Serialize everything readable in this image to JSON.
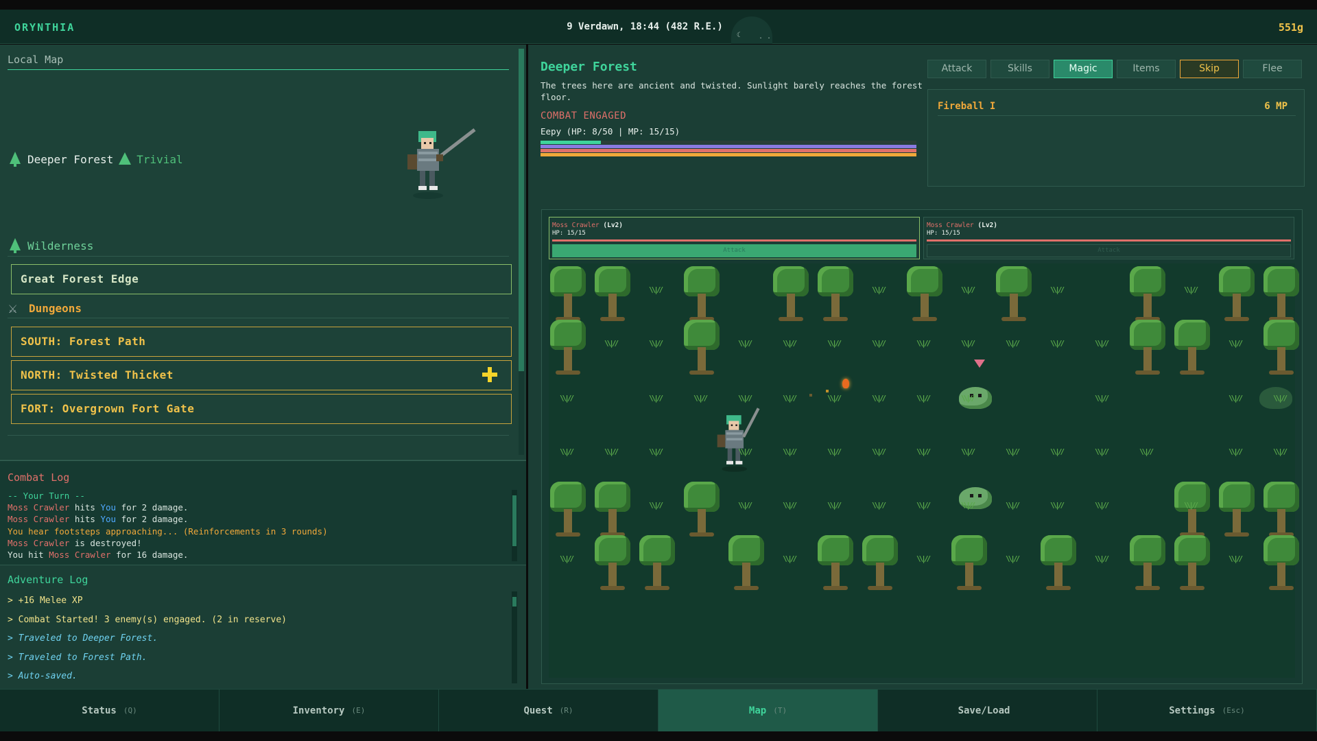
{
  "header": {
    "title": "ORYNTHIA",
    "datetime": "9 Verdawn, 18:44 (482 R.E.)",
    "gold": "551g"
  },
  "local_map": {
    "title": "Local Map",
    "current_location": "Deeper Forest",
    "current_level": "Trivial",
    "sections": {
      "wilderness": {
        "label": "Wilderness",
        "destinations": [
          "Great Forest Edge"
        ]
      },
      "dungeons": {
        "label": "Dungeons",
        "destinations": [
          "SOUTH: Forest Path",
          "NORTH: Twisted Thicket",
          "FORT: Overgrown Fort Gate"
        ]
      }
    }
  },
  "combat_log": {
    "title": "Combat Log",
    "turn_header": "-- Your Turn --",
    "lines": [
      {
        "actor": "Moss Crawler",
        "verb": " hits ",
        "target": "You",
        "rest": " for 2 damage."
      },
      {
        "actor": "Moss Crawler",
        "verb": " hits ",
        "target": "You",
        "rest": " for 2 damage."
      },
      {
        "warning": "You hear footsteps approaching... (Reinforcements in 3 rounds)"
      },
      {
        "actor": "Moss Crawler",
        "rest": " is destroyed!"
      },
      {
        "lead": "You hit ",
        "target": "Moss Crawler",
        "rest": " for 16 damage."
      }
    ]
  },
  "adventure_log": {
    "title": "Adventure Log",
    "entries": [
      "> +16 Melee XP",
      "> Combat Started! 3 enemy(s) engaged. (2 in reserve)",
      "> Traveled to Deeper Forest.",
      "> Traveled to Forest Path.",
      "> Auto-saved."
    ]
  },
  "area": {
    "title": "Deeper Forest",
    "description": "The trees here are ancient and twisted. Sunlight barely reaches the forest floor.",
    "combat_status": "COMBAT ENGAGED",
    "player_stats": "Eepy (HP: 8/50 | MP: 15/15)",
    "player": {
      "hp": 8,
      "hp_max": 50,
      "mp": 15,
      "mp_max": 15
    }
  },
  "actions": {
    "tabs": [
      "Attack",
      "Skills",
      "Magic",
      "Items",
      "Skip",
      "Flee"
    ],
    "active": "Magic"
  },
  "spells": [
    {
      "name": "Fireball I",
      "cost": "6 MP"
    }
  ],
  "enemies": [
    {
      "name": "Moss Crawler",
      "level": "(Lv2)",
      "hp": "HP: 15/15",
      "button": "Attack"
    },
    {
      "name": "Moss Crawler",
      "level": "(Lv2)",
      "hp": "HP: 15/15",
      "button": "Attack"
    }
  ],
  "nav": [
    {
      "label": "Status",
      "key": "(Q)"
    },
    {
      "label": "Inventory",
      "key": "(E)"
    },
    {
      "label": "Quest",
      "key": "(R)"
    },
    {
      "label": "Map",
      "key": "(T)"
    },
    {
      "label": "Save/Load",
      "key": ""
    },
    {
      "label": "Settings",
      "key": "(Esc)"
    }
  ],
  "nav_active": "Map"
}
